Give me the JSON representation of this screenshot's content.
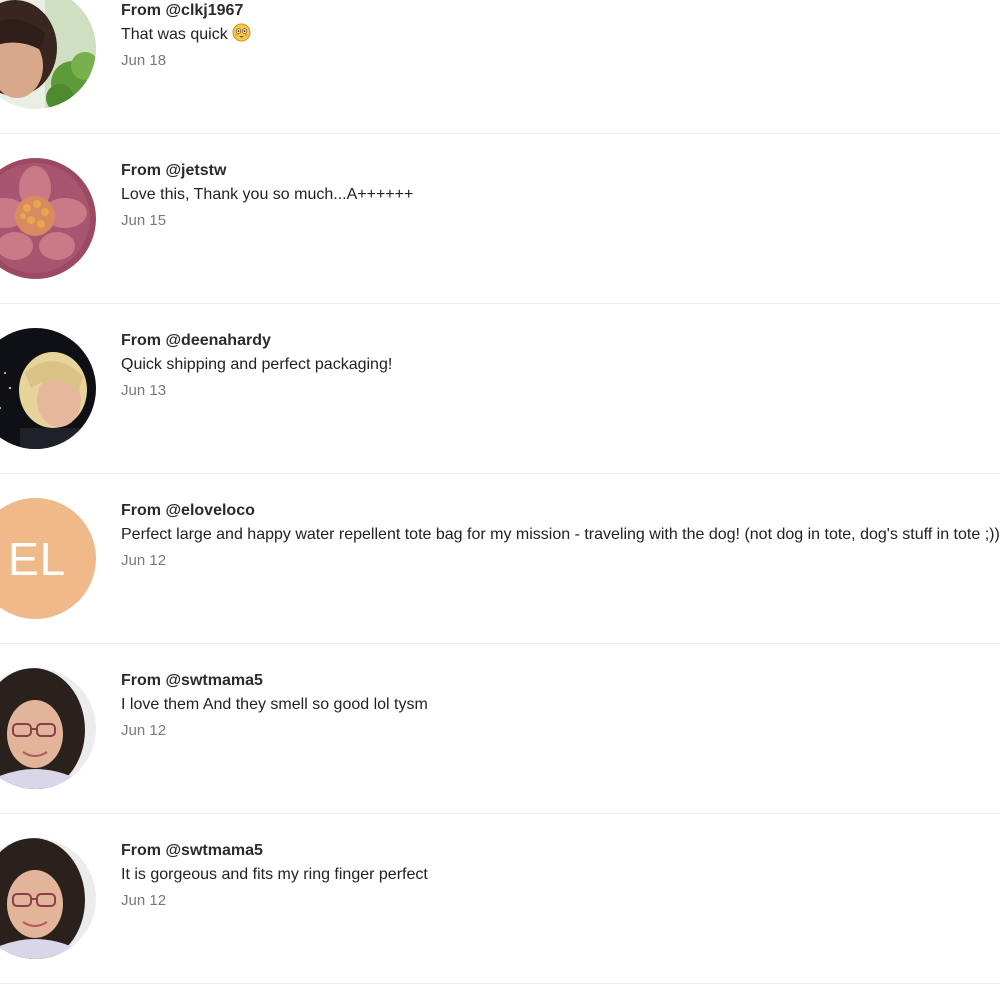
{
  "feed": {
    "items": [
      {
        "from_label": "From",
        "handle": "@clkj1967",
        "message": "That was quick",
        "emoji": "flushed-face-emoji",
        "date": "Jun 18",
        "avatar": "photo-woman-dark-hair-greenery"
      },
      {
        "from_label": "From",
        "handle": "@jetstw",
        "message": "Love this, Thank you so much...A++++++",
        "date": "Jun 15",
        "avatar": "photo-pink-flower"
      },
      {
        "from_label": "From",
        "handle": "@deenahardy",
        "message": "Quick shipping and perfect packaging!",
        "date": "Jun 13",
        "avatar": "photo-blonde-woman-night-city"
      },
      {
        "from_label": "From",
        "handle": "@eloveloco",
        "message": "Perfect large and happy water repellent tote bag for my mission - traveling with the dog! (not dog in tote, dog's stuff in tote ;))",
        "date": "Jun 12",
        "avatar": "monogram",
        "initials": "EL",
        "avatar_color": "#efb98a"
      },
      {
        "from_label": "From",
        "handle": "@swtmama5",
        "message": "I love them And they smell so good lol tysm",
        "date": "Jun 12",
        "avatar": "photo-woman-curly-hair-glasses"
      },
      {
        "from_label": "From",
        "handle": "@swtmama5",
        "message": "It is gorgeous and fits my ring finger perfect",
        "date": "Jun 12",
        "avatar": "photo-woman-curly-hair-glasses"
      }
    ]
  },
  "colors": {
    "divider": "#ececec",
    "date_text": "#7a7a7a",
    "monogram_bg": "#efb98a"
  }
}
